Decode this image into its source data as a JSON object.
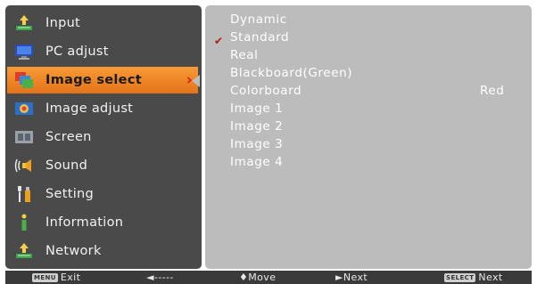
{
  "menu": {
    "items": [
      {
        "label": "Input",
        "icon": "input-icon"
      },
      {
        "label": "PC adjust",
        "icon": "pc-adjust-icon"
      },
      {
        "label": "Image select",
        "icon": "image-select-icon",
        "selected": true
      },
      {
        "label": "Image adjust",
        "icon": "image-adjust-icon"
      },
      {
        "label": "Screen",
        "icon": "screen-icon"
      },
      {
        "label": "Sound",
        "icon": "sound-icon"
      },
      {
        "label": "Setting",
        "icon": "setting-icon"
      },
      {
        "label": "Information",
        "icon": "information-icon"
      },
      {
        "label": "Network",
        "icon": "network-icon"
      }
    ],
    "selected_arrow": "›"
  },
  "submenu": {
    "items": [
      {
        "label": "Dynamic"
      },
      {
        "label": "Standard",
        "checked": true
      },
      {
        "label": "Real"
      },
      {
        "label": "Blackboard(Green)"
      },
      {
        "label": "Colorboard",
        "value": "Red"
      },
      {
        "label": "Image 1"
      },
      {
        "label": "Image 2"
      },
      {
        "label": "Image 3"
      },
      {
        "label": "Image 4"
      }
    ],
    "check_mark": "✔"
  },
  "bottombar": {
    "exit_key": "MENU",
    "exit_label": "Exit",
    "back_label": "◄-----",
    "move_label": "♦Move",
    "next_label": "►Next",
    "select_key": "SELECT",
    "select_label": "Next"
  },
  "colors": {
    "menu_bg": "#4a4a4a",
    "submenu_bg": "#bcbcbc",
    "selected_bg": "#f0882a",
    "check": "#b51d12"
  }
}
